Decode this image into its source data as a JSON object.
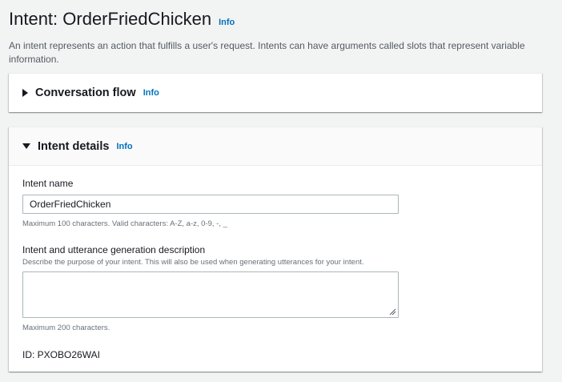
{
  "header": {
    "title": "Intent: OrderFriedChicken",
    "info_label": "Info",
    "description": "An intent represents an action that fulfills a user's request. Intents can have arguments called slots that represent variable information."
  },
  "conversation_flow": {
    "title": "Conversation flow",
    "info_label": "Info",
    "expanded": false
  },
  "intent_details": {
    "title": "Intent details",
    "info_label": "Info",
    "expanded": true,
    "intent_name": {
      "label": "Intent name",
      "value": "OrderFriedChicken",
      "constraint": "Maximum 100 characters. Valid characters: A-Z, a-z, 0-9, -, _"
    },
    "generation_description": {
      "label": "Intent and utterance generation description",
      "description": "Describe the purpose of your intent. This will also be used when generating utterances for your intent.",
      "value": "",
      "constraint": "Maximum 200 characters."
    },
    "id_text": "ID: PXOBO26WAI"
  },
  "colors": {
    "link": "#0073bb",
    "background": "#f2f3f3",
    "text": "#16191f",
    "secondary_text": "#545b64"
  }
}
